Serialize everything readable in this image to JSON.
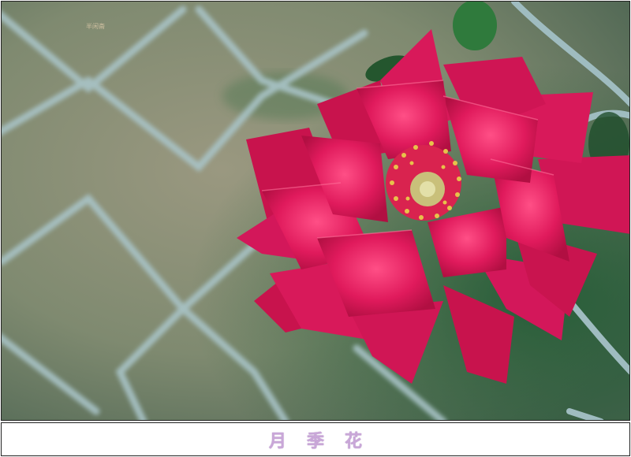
{
  "photo": {
    "subject": "rose-and-chain-link-fence",
    "colors": {
      "petal": "#e01a5c",
      "petal_dark": "#a50d3c",
      "petal_light": "#ff5a8a",
      "stamen": "#e8c24a",
      "fence": "#9fbcc0",
      "background": "#7f8a6f",
      "leaf": "#2f6b3a"
    }
  },
  "watermark": {
    "text": "半闲斋"
  },
  "caption": {
    "text": "月季花",
    "color": "#c9a7d8"
  }
}
